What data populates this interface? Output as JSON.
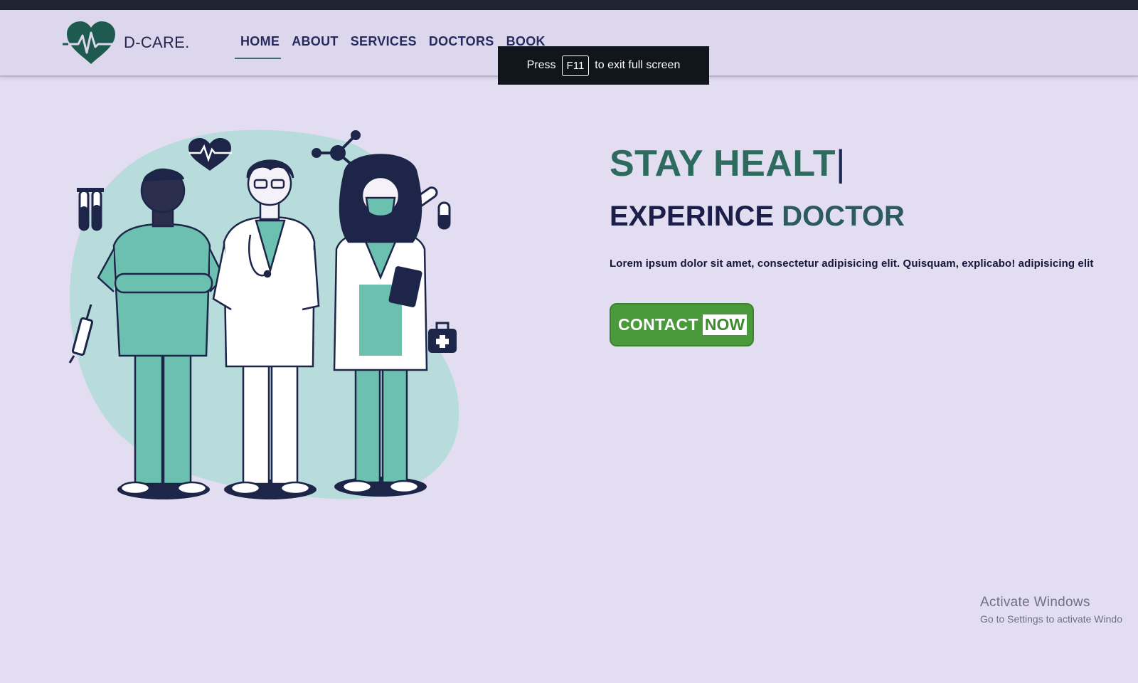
{
  "brand": {
    "name": "D-CARE.",
    "logo_icon": "heart-pulse-icon",
    "accent": "#2d6b5e"
  },
  "nav": {
    "items": [
      {
        "label": "HOME",
        "active": true
      },
      {
        "label": "ABOUT",
        "active": false
      },
      {
        "label": "SERVICES",
        "active": false
      },
      {
        "label": "DOCTORS",
        "active": false
      },
      {
        "label": "BOOK",
        "active": false
      }
    ]
  },
  "fullscreen_toast": {
    "prefix": "Press",
    "key": "F11",
    "suffix": "to exit full screen"
  },
  "hero": {
    "headline": "STAY HEALT",
    "caret": "|",
    "subheadline_a": "EXPERINCE",
    "subheadline_b": "DOCTOR",
    "description": "Lorem ipsum dolor sit amet, consectetur adipisicing elit. Quisquam, explicabo! adipisicing elit",
    "cta_a": "CONTACT",
    "cta_b": "NOW",
    "cta_color": "#4a9a3c"
  },
  "watermark": {
    "title": "Activate Windows",
    "subtitle": "Go to Settings to activate Windo"
  }
}
